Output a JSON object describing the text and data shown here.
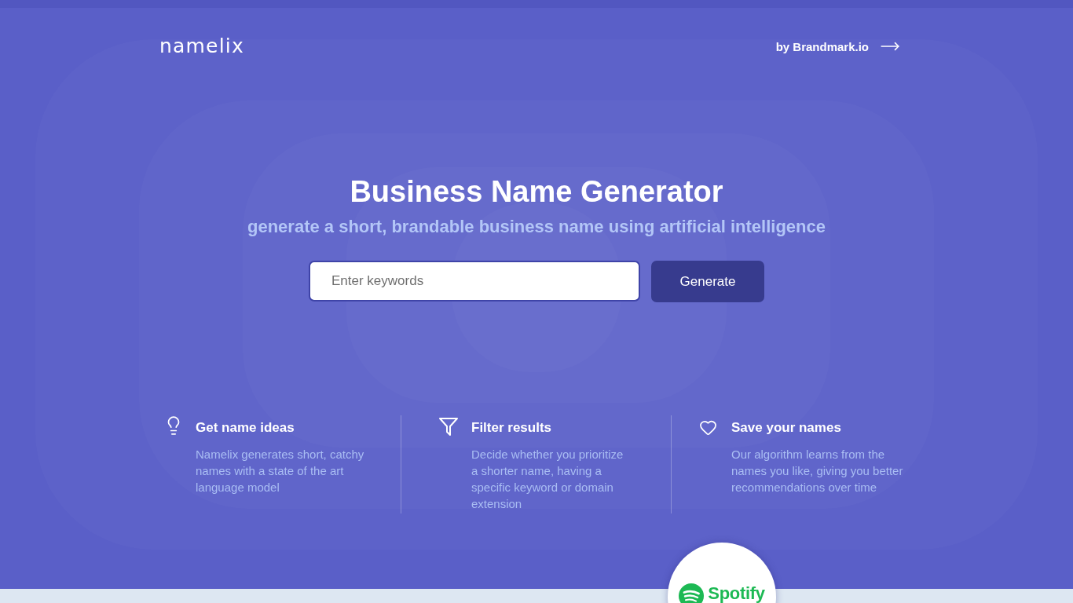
{
  "header": {
    "logo": "namelix",
    "link": "by Brandmark.io"
  },
  "hero": {
    "title": "Business Name Generator",
    "subtitle": "generate a short, brandable business name using artificial intelligence"
  },
  "search": {
    "placeholder": "Enter keywords",
    "button": "Generate"
  },
  "features": [
    {
      "title": "Get name ideas",
      "description": "Namelix generates short, catchy names with a state of the art language model"
    },
    {
      "title": "Filter results",
      "description": "Decide whether you prioritize a shorter name, having a specific keyword or domain extension"
    },
    {
      "title": "Save your names",
      "description": "Our algorithm learns from the names you like, giving you better recommendations over time"
    }
  ],
  "partner_badge": {
    "label": "Spotify"
  }
}
